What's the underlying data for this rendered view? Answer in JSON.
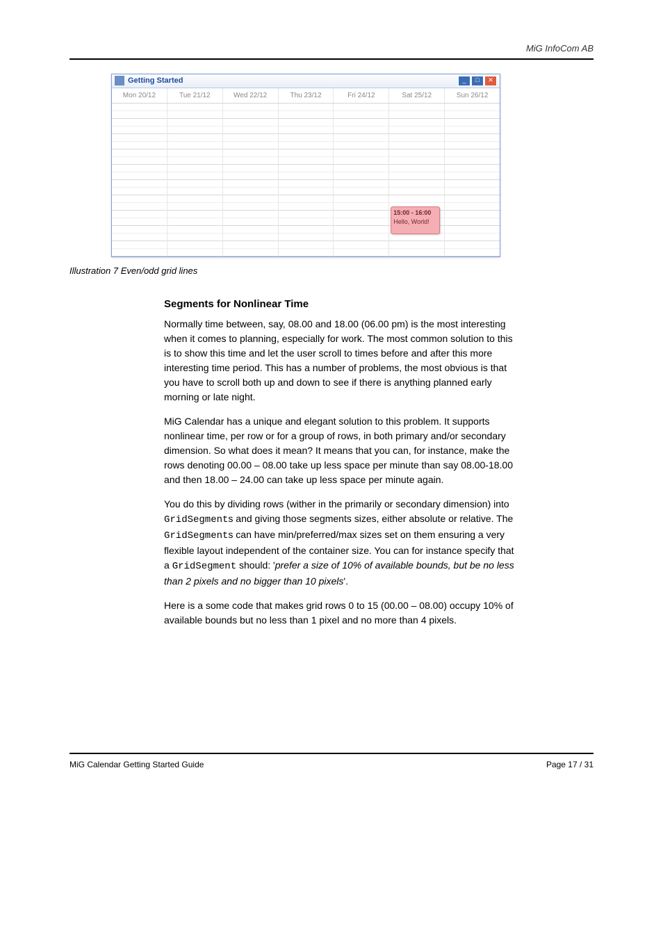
{
  "brand": "MiG InfoCom AB",
  "window": {
    "title": "Getting Started",
    "days": [
      "Mon 20/12",
      "Tue 21/12",
      "Wed 22/12",
      "Thu 23/12",
      "Fri 24/12",
      "Sat 25/12",
      "Sun 26/12"
    ],
    "event": {
      "time": "15:00 - 16:00",
      "label": "Hello, World!"
    }
  },
  "illustration_caption": "Illustration 7 Even/odd grid lines",
  "heading": "Segments for Nonlinear Time",
  "p1": "Normally time between, say, 08.00 and 18.00 (06.00 pm) is the most interesting when it comes to planning, especially for work. The most common solution to this is to show this time and let the user scroll to times before and after this more interesting time period. This has a number of problems, the most obvious is that you have to scroll both up and down to see if there is anything planned early morning or late night.",
  "p2": "MiG Calendar has a unique and elegant solution to this problem. It supports nonlinear time, per row or for a group of rows, in both primary and/or secondary dimension. So what does it mean? It means that you can, for instance, make the rows denoting 00.00 – 08.00 take up less space per minute than say 08.00-18.00 and then 18.00 – 24.00 can take up less space per minute again.",
  "p3a": "You do this by dividing rows (wither in the primarily or secondary dimension) into ",
  "p3_code1": "GridSegment",
  "p3b": "s and giving those segments sizes, either absolute or relative. The ",
  "p3_code2": "GridSegment",
  "p3c": "s  can have min/preferred/max sizes set on them ensuring a very flexible layout independent of the container size. You can for instance specify that a ",
  "p3_code3": "GridSegment",
  "p3d": " should: '",
  "p3_emph": "prefer a size of 10% of available bounds, but be no less than 2 pixels and no bigger than 10 pixels",
  "p3e": "'.",
  "p4": "Here is a some code that makes grid rows 0 to 15 (00.00 – 08.00) occupy 10% of available bounds but no less than 1 pixel and no more than 4 pixels.",
  "footer": {
    "left": "MiG Calendar Getting Started Guide",
    "right": "Page 17 / 31"
  }
}
